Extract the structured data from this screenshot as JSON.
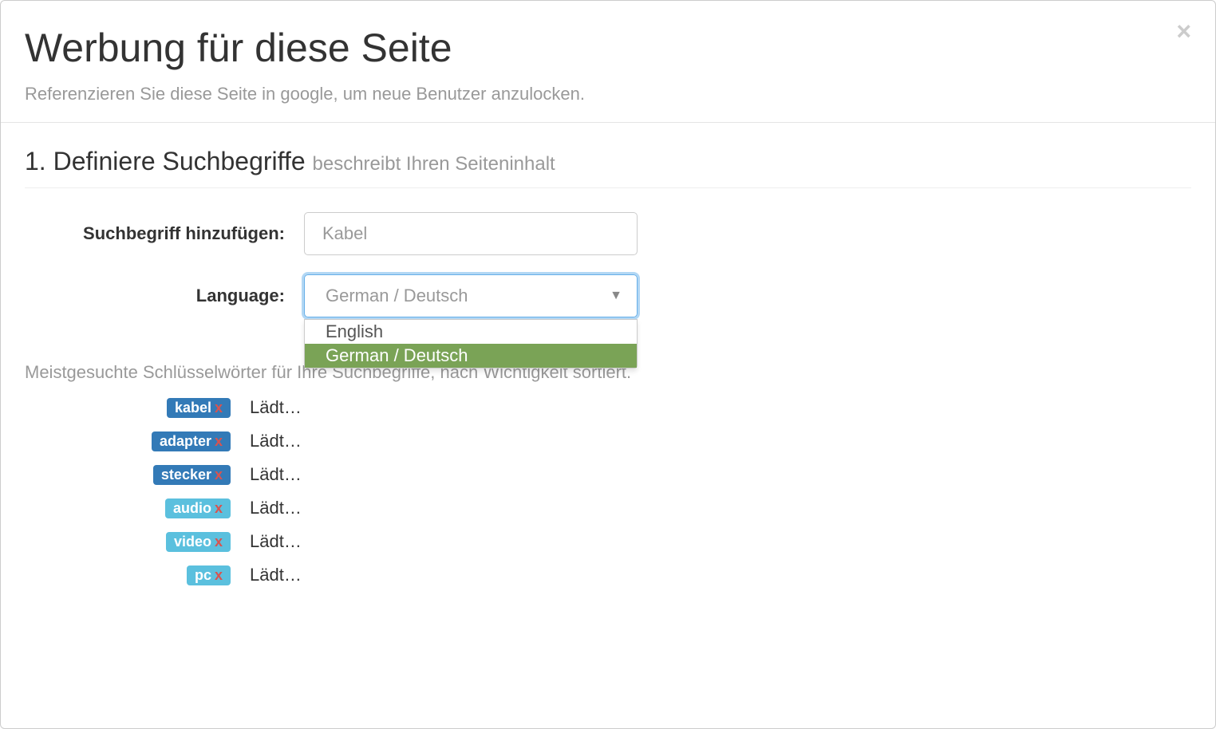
{
  "header": {
    "title": "Werbung für diese Seite",
    "subtitle": "Referenzieren Sie diese Seite in google, um neue Benutzer anzulocken."
  },
  "section1": {
    "title": "1. Definiere Suchbegriffe",
    "subtitle": "beschreibt Ihren Seiteninhalt",
    "keyword_label": "Suchbegriff hinzufügen:",
    "keyword_placeholder": "Kabel",
    "language_label": "Language:",
    "language_value": "German / Deutsch",
    "language_options": {
      "opt0": "English",
      "opt1": "German / Deutsch"
    }
  },
  "keywords": {
    "intro": "Meistgesuchte Schlüsselwörter für Ihre Suchbegriffe, nach Wichtigkeit sortiert.",
    "loading": "Lädt…",
    "remove": "x",
    "items": {
      "k0": {
        "term": "kabel",
        "type": "primary"
      },
      "k1": {
        "term": "adapter",
        "type": "primary"
      },
      "k2": {
        "term": "stecker",
        "type": "primary"
      },
      "k3": {
        "term": "audio",
        "type": "info"
      },
      "k4": {
        "term": "video",
        "type": "info"
      },
      "k5": {
        "term": "pc",
        "type": "info"
      }
    }
  }
}
